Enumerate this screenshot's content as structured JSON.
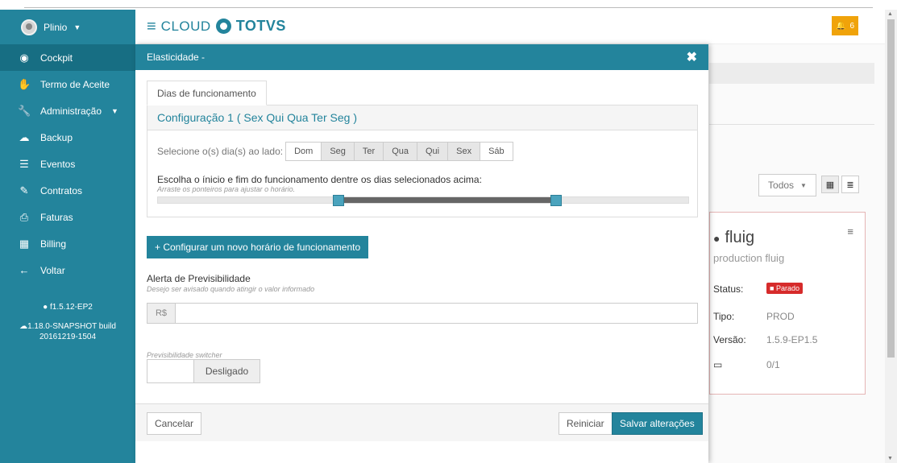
{
  "user": {
    "name": "Plinio"
  },
  "sidebar": {
    "items": [
      {
        "label": "Cockpit",
        "icon": "dashboard-icon"
      },
      {
        "label": "Termo de Aceite",
        "icon": "handshake-icon"
      },
      {
        "label": "Administração",
        "icon": "wrench-icon"
      },
      {
        "label": "Backup",
        "icon": "cloud-upload-icon"
      },
      {
        "label": "Eventos",
        "icon": "list-icon"
      },
      {
        "label": "Contratos",
        "icon": "contract-icon"
      },
      {
        "label": "Faturas",
        "icon": "invoice-icon"
      },
      {
        "label": "Billing",
        "icon": "billing-icon"
      },
      {
        "label": "Voltar",
        "icon": "arrow-left-icon"
      }
    ],
    "version": "f1.5.12-EP2",
    "build_line1": "1.18.0-SNAPSHOT build",
    "build_line2": "20161219-1504"
  },
  "header": {
    "cloud": "CLOUD",
    "brand": "TOTVS",
    "notifications": "6"
  },
  "background": {
    "filter": "Todos",
    "card": {
      "title": "fluig",
      "subtitle": "production fluig",
      "status_label": "Status:",
      "status_value": "Parado",
      "type_label": "Tipo:",
      "type_value": "PROD",
      "version_label": "Versão:",
      "version_value": "1.5.9-EP1.5",
      "servers_value": "0/1"
    }
  },
  "modal": {
    "title": "Elasticidade -",
    "tab": "Dias de funcionamento",
    "config_title": "Configuração 1 ( Sex Qui Qua Ter Seg )",
    "days_label": "Selecione o(s) dia(s) ao lado:",
    "days": [
      {
        "label": "Dom",
        "selected": false
      },
      {
        "label": "Seg",
        "selected": true
      },
      {
        "label": "Ter",
        "selected": true
      },
      {
        "label": "Qua",
        "selected": true
      },
      {
        "label": "Qui",
        "selected": true
      },
      {
        "label": "Sex",
        "selected": true
      },
      {
        "label": "Sáb",
        "selected": false
      }
    ],
    "range_title": "Escolha o ínicio e fim do funcionamento dentre os dias selecionados acima:",
    "range_hint": "Arraste os ponteiros para ajustar o horário.",
    "range_start_fraction": 0.34,
    "range_end_fraction": 0.75,
    "new_config_button": "+ Configurar um novo horário de funcionamento",
    "alert_title": "Alerta de Previsibilidade",
    "alert_hint": "Desejo ser avisado quando atingir o valor informado",
    "currency": "R$",
    "amount_value": "",
    "switch_label": "Previsibilidade switcher",
    "switch_state": "Desligado",
    "cancel": "Cancelar",
    "reset": "Reiniciar",
    "save": "Salvar alterações"
  },
  "colors": {
    "primary": "#23849c",
    "primary_dark": "#176e83",
    "notification": "#f0a30a",
    "danger": "#d62b2b"
  }
}
